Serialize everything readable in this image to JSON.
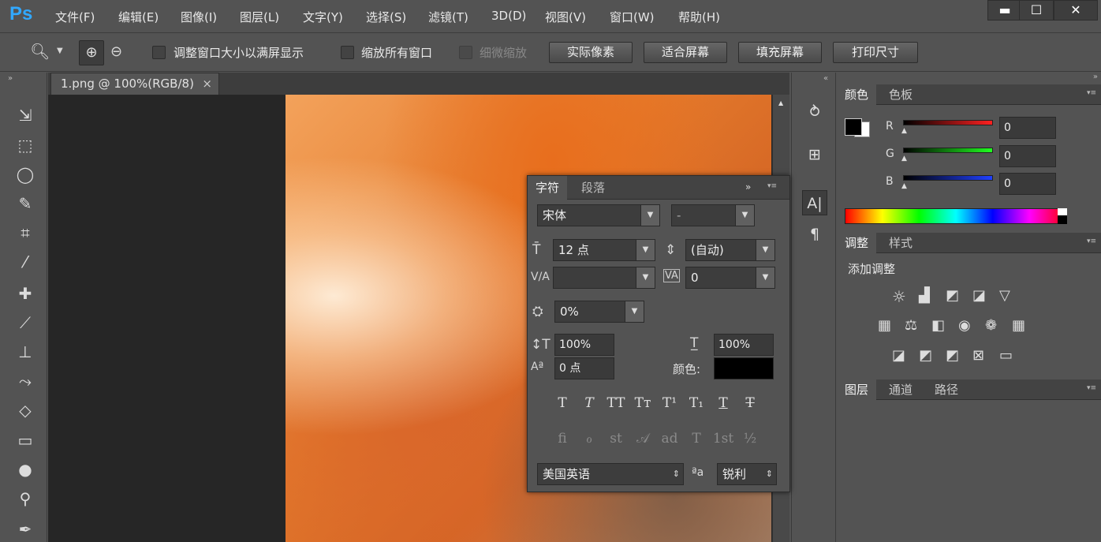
{
  "app": {
    "logo": "Ps"
  },
  "menu": [
    "文件(F)",
    "编辑(E)",
    "图像(I)",
    "图层(L)",
    "文字(Y)",
    "选择(S)",
    "滤镜(T)",
    "3D(D)",
    "视图(V)",
    "窗口(W)",
    "帮助(H)"
  ],
  "window_controls": {
    "minimize": "▬",
    "restore": "☐",
    "close": "✕"
  },
  "options": {
    "resize_window": "调整窗口大小以满屏显示",
    "zoom_all": "缩放所有窗口",
    "scrubby_zoom": "细微缩放",
    "actual_pixels": "实际像素",
    "fit_screen": "适合屏幕",
    "fill_screen": "填充屏幕",
    "print_size": "打印尺寸"
  },
  "document": {
    "tab": "1.png @ 100%(RGB/8)",
    "close": "×"
  },
  "color_panel": {
    "tab_active": "颜色",
    "tab_other": "色板",
    "r_label": "R",
    "g_label": "G",
    "b_label": "B",
    "r": "0",
    "g": "0",
    "b": "0",
    "fg_color": "#000000",
    "bg_color": "#ffffff"
  },
  "adjust_panel": {
    "tab_active": "调整",
    "tab_other": "样式",
    "title": "添加调整"
  },
  "layers_panel": {
    "tab_active": "图层",
    "tab_2": "通道",
    "tab_3": "路径"
  },
  "char_panel": {
    "tab_active": "字符",
    "tab_other": "段落",
    "font_family": "宋体",
    "font_style": "-",
    "size": "12 点",
    "leading": "(自动)",
    "kerning": "",
    "tracking": "0",
    "scale_pct": "0%",
    "vscale": "100%",
    "hscale": "100%",
    "baseline": "0 点",
    "color_label": "颜色:",
    "color": "#000000",
    "language": "美国英语",
    "aa_icon": "ªa",
    "antialias": "锐利",
    "typo_buttons": [
      "T",
      "T",
      "TT",
      "Tт",
      "T¹",
      "T₁",
      "T",
      "T"
    ],
    "otf_buttons": [
      "ﬁ",
      "ℴ",
      "st",
      "𝒜",
      "ad",
      "T",
      "1st",
      "½"
    ]
  }
}
